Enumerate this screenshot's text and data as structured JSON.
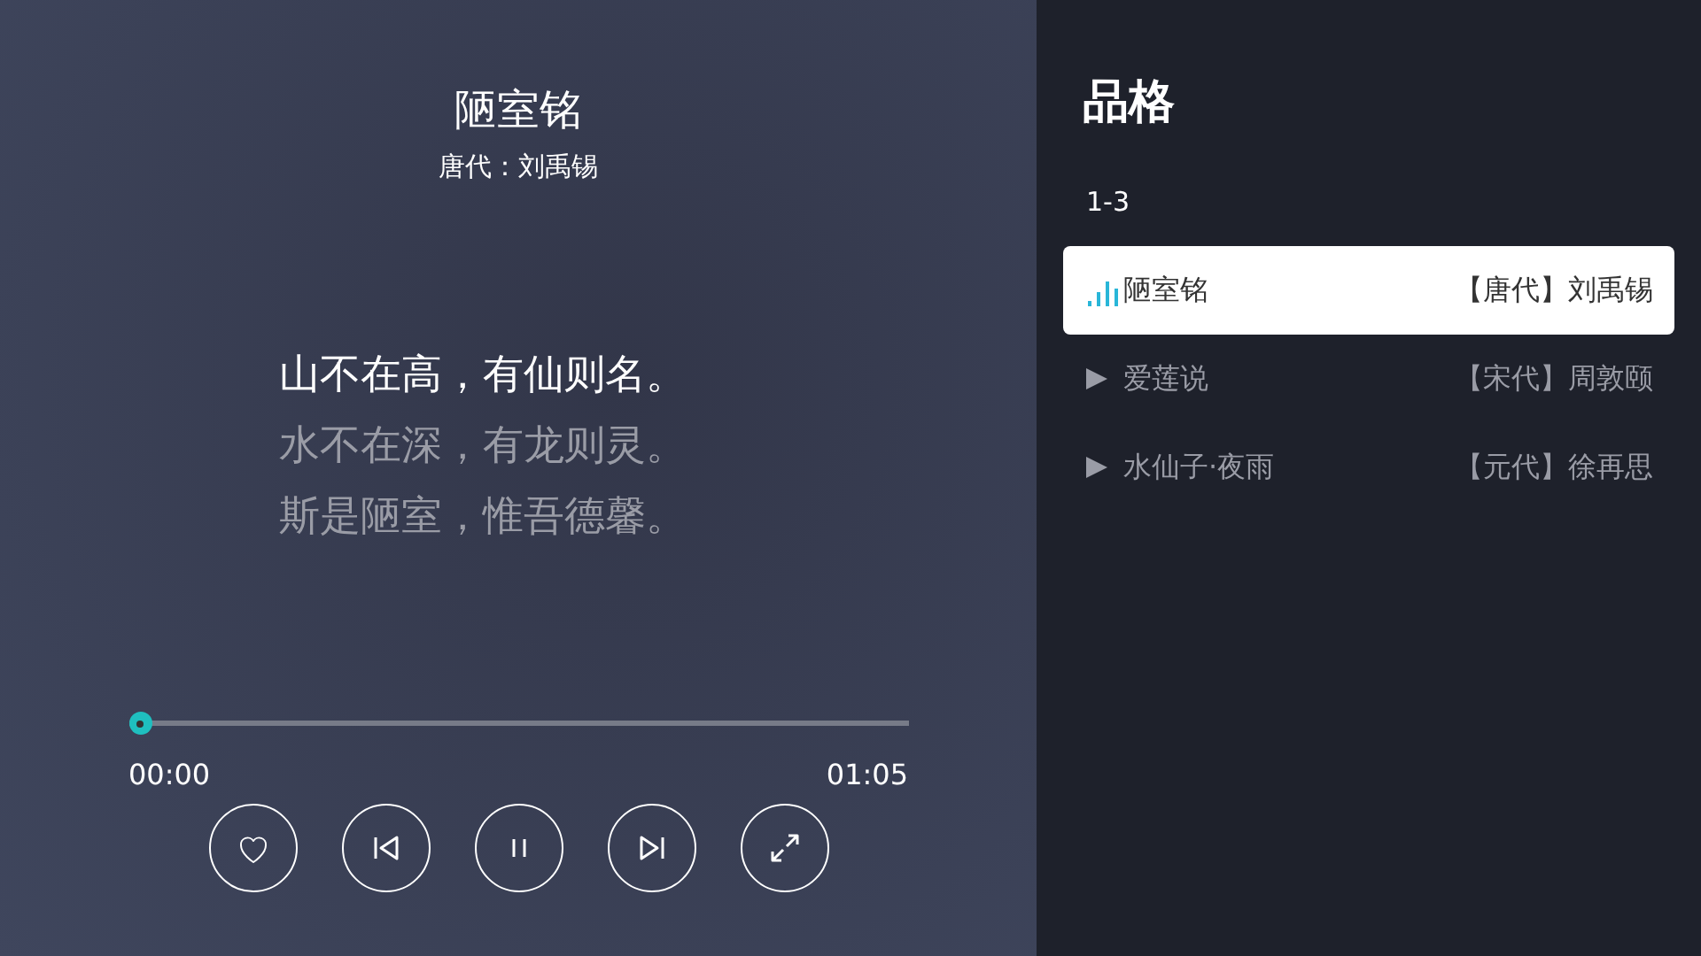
{
  "player": {
    "title": "陋室铭",
    "subtitle": "唐代：刘禹锡",
    "lyrics": [
      {
        "text": "山不在高，有仙则名。",
        "selected": true
      },
      {
        "text": "水不在深，有龙则灵。",
        "selected": false
      },
      {
        "text": "斯是陋室，惟吾德馨。",
        "selected": false
      }
    ],
    "progress": {
      "elapsed": "00:00",
      "duration": "01:05"
    },
    "controls": [
      {
        "kind": "favorite"
      },
      {
        "kind": "previous"
      },
      {
        "kind": "pause"
      },
      {
        "kind": "next"
      },
      {
        "kind": "fullscreen"
      }
    ]
  },
  "playlist": {
    "title": "品格",
    "range": "1-3",
    "items": [
      {
        "title": "陋室铭",
        "author": "【唐代】刘禹锡",
        "selected": true
      },
      {
        "title": "爱莲说",
        "author": "【宋代】周敦颐",
        "selected": false
      },
      {
        "title": "水仙子·夜雨",
        "author": "【元代】徐再思",
        "selected": false
      }
    ]
  }
}
